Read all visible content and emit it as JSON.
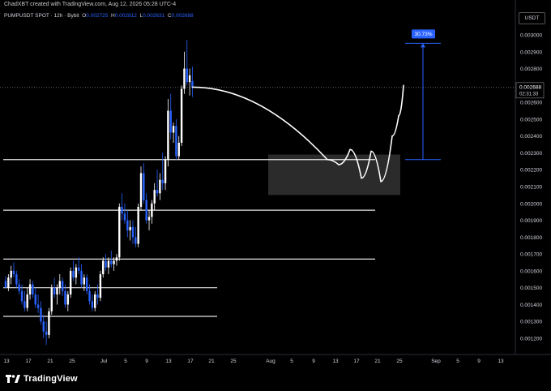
{
  "header": {
    "caption": "ChadXBT created with TradingView.com, Aug 12, 2026 05:28 UTC-4",
    "symbol_line": "PUMPUSDT SPOT · 12h · Bybit",
    "o_label": "O",
    "o_value": "0.002725",
    "h_label": "H",
    "h_value": "0.002812",
    "l_label": "L",
    "l_value": "0.002631",
    "c_label": "C",
    "c_value": "0.002688",
    "currency": "USDT"
  },
  "footer": {
    "brand": "TradingView",
    "logo_icon": "tradingview-logo-icon"
  },
  "colors": {
    "up": "#ffffff",
    "down": "#2962ff",
    "accent": "#2962ff",
    "background": "#000000"
  },
  "chart_data": {
    "type": "candlestick",
    "timeframe": "12h",
    "grid": false,
    "ylim": [
      0.00115,
      0.00305
    ],
    "y_ticks": [
      "0.003000",
      "0.002900",
      "0.002800",
      "0.002600",
      "0.002500",
      "0.002400",
      "0.002300",
      "0.002200",
      "0.002100",
      "0.002000",
      "0.001900",
      "0.001800",
      "0.001700",
      "0.001600",
      "0.001500",
      "0.001400",
      "0.001300",
      "0.001200"
    ],
    "x_ticks": [
      "13",
      "17",
      "21",
      "25",
      "Jul",
      "5",
      "9",
      "13",
      "17",
      "21",
      "25",
      "Aug",
      "5",
      "9",
      "13",
      "17",
      "21",
      "25",
      "Sep",
      "5",
      "9",
      "13"
    ],
    "last_price": "0.002688",
    "countdown": "02:31:33",
    "measure_label": "30.73%",
    "levels": [
      0.00226,
      0.00196,
      0.00167,
      0.0015,
      0.00133
    ],
    "support_zone": [
      0.00205,
      0.00229
    ],
    "measure_range": [
      0.00226,
      0.00295
    ],
    "projection": [
      [
        0.00269,
        0.00226
      ],
      [
        0.00226,
        0.00223
      ],
      [
        0.00223,
        0.00232
      ],
      [
        0.00232,
        0.00215
      ],
      [
        0.00215,
        0.00231
      ],
      [
        0.00231,
        0.00213
      ],
      [
        0.00213,
        0.0024
      ],
      [
        0.0024,
        0.00252
      ],
      [
        0.00252,
        0.0027
      ]
    ],
    "candles": [
      [
        0.00154,
        0.00157,
        0.0015,
        0.0015
      ],
      [
        0.0015,
        0.00158,
        0.00148,
        0.00156
      ],
      [
        0.00156,
        0.00163,
        0.00152,
        0.0016
      ],
      [
        0.0016,
        0.00165,
        0.00156,
        0.00158
      ],
      [
        0.00158,
        0.0016,
        0.0015,
        0.00152
      ],
      [
        0.00152,
        0.00155,
        0.00146,
        0.00148
      ],
      [
        0.00148,
        0.00152,
        0.0014,
        0.00142
      ],
      [
        0.00142,
        0.00148,
        0.00136,
        0.00138
      ],
      [
        0.00138,
        0.0015,
        0.00136,
        0.00146
      ],
      [
        0.00146,
        0.00155,
        0.00143,
        0.00152
      ],
      [
        0.00152,
        0.00154,
        0.00144,
        0.00146
      ],
      [
        0.00146,
        0.0015,
        0.00138,
        0.0014
      ],
      [
        0.0014,
        0.00146,
        0.00135,
        0.00138
      ],
      [
        0.00138,
        0.00142,
        0.00128,
        0.0013
      ],
      [
        0.0013,
        0.00134,
        0.0012,
        0.00124
      ],
      [
        0.00124,
        0.0013,
        0.00116,
        0.00122
      ],
      [
        0.00122,
        0.00138,
        0.0012,
        0.00136
      ],
      [
        0.00136,
        0.00152,
        0.00134,
        0.0015
      ],
      [
        0.0015,
        0.00156,
        0.00144,
        0.00146
      ],
      [
        0.00146,
        0.00152,
        0.0014,
        0.0015
      ],
      [
        0.0015,
        0.00158,
        0.00146,
        0.00154
      ],
      [
        0.00154,
        0.00156,
        0.00145,
        0.00148
      ],
      [
        0.00148,
        0.00152,
        0.00138,
        0.0014
      ],
      [
        0.0014,
        0.00148,
        0.00136,
        0.00146
      ],
      [
        0.00146,
        0.00162,
        0.00144,
        0.0016
      ],
      [
        0.0016,
        0.00166,
        0.00154,
        0.00156
      ],
      [
        0.00156,
        0.00164,
        0.00152,
        0.00162
      ],
      [
        0.00162,
        0.00168,
        0.00158,
        0.0016
      ],
      [
        0.0016,
        0.00164,
        0.0015,
        0.00152
      ],
      [
        0.00152,
        0.00158,
        0.00148,
        0.00156
      ],
      [
        0.00156,
        0.00158,
        0.00146,
        0.00148
      ],
      [
        0.00148,
        0.00152,
        0.0014,
        0.00142
      ],
      [
        0.00142,
        0.00146,
        0.00136,
        0.00138
      ],
      [
        0.00138,
        0.00148,
        0.00136,
        0.00146
      ],
      [
        0.00146,
        0.00152,
        0.0014,
        0.00144
      ],
      [
        0.00144,
        0.0016,
        0.00142,
        0.00158
      ],
      [
        0.00158,
        0.00168,
        0.00156,
        0.00166
      ],
      [
        0.00166,
        0.0017,
        0.0016,
        0.00162
      ],
      [
        0.00162,
        0.00168,
        0.00158,
        0.00166
      ],
      [
        0.00166,
        0.00172,
        0.00162,
        0.00164
      ],
      [
        0.00164,
        0.00168,
        0.0016,
        0.00166
      ],
      [
        0.00166,
        0.0017,
        0.00163,
        0.00168
      ],
      [
        0.00168,
        0.002,
        0.00166,
        0.00198
      ],
      [
        0.00198,
        0.00206,
        0.0019,
        0.00194
      ],
      [
        0.00194,
        0.002,
        0.00188,
        0.0019
      ],
      [
        0.0019,
        0.00196,
        0.0018,
        0.00184
      ],
      [
        0.00184,
        0.0019,
        0.00178,
        0.00186
      ],
      [
        0.00186,
        0.0019,
        0.00176,
        0.0018
      ],
      [
        0.0018,
        0.00186,
        0.00174,
        0.00176
      ],
      [
        0.00176,
        0.002,
        0.00174,
        0.00198
      ],
      [
        0.00198,
        0.00222,
        0.00196,
        0.00218
      ],
      [
        0.00218,
        0.00224,
        0.002,
        0.00202
      ],
      [
        0.00202,
        0.00206,
        0.00188,
        0.0019
      ],
      [
        0.0019,
        0.00196,
        0.00184,
        0.00192
      ],
      [
        0.00192,
        0.00202,
        0.00188,
        0.002
      ],
      [
        0.002,
        0.00212,
        0.00196,
        0.00208
      ],
      [
        0.00208,
        0.0022,
        0.00204,
        0.00206
      ],
      [
        0.00206,
        0.00218,
        0.00202,
        0.00214
      ],
      [
        0.00214,
        0.0023,
        0.00208,
        0.00212
      ],
      [
        0.00212,
        0.00228,
        0.00208,
        0.00226
      ],
      [
        0.00226,
        0.00262,
        0.00222,
        0.00255
      ],
      [
        0.00255,
        0.00265,
        0.00238,
        0.00242
      ],
      [
        0.00242,
        0.00248,
        0.00236,
        0.00246
      ],
      [
        0.00246,
        0.0025,
        0.00226,
        0.00228
      ],
      [
        0.00228,
        0.0024,
        0.00226,
        0.00236
      ],
      [
        0.00236,
        0.0027,
        0.00234,
        0.00268
      ],
      [
        0.00268,
        0.0029,
        0.00265,
        0.0028
      ],
      [
        0.0028,
        0.00297,
        0.0027,
        0.00272
      ],
      [
        0.00272,
        0.0028,
        0.00264,
        0.00276
      ],
      [
        0.002725,
        0.002812,
        0.002631,
        0.002688
      ]
    ]
  }
}
